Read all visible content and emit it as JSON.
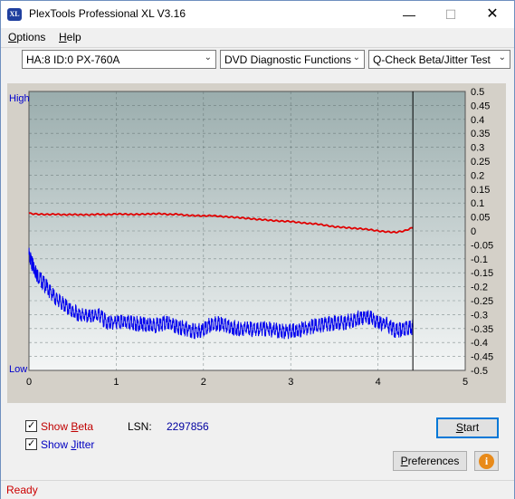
{
  "window": {
    "title": "PlexTools Professional XL V3.16",
    "icon_label": "XL",
    "minimize": "—",
    "maximize": "☐",
    "close": "✕"
  },
  "menu": [
    {
      "label": "Options",
      "mnemonic": "O",
      "rest": "ptions"
    },
    {
      "label": "Help",
      "mnemonic": "H",
      "rest": "elp"
    }
  ],
  "toolbar": {
    "drive": "HA:8 ID:0  PX-760A",
    "function": "DVD Diagnostic Functions",
    "test": "Q-Check Beta/Jitter Test",
    "arrow": "⌄"
  },
  "chart_data": {
    "type": "line",
    "x_ticks": [
      "0",
      "1",
      "2",
      "3",
      "4",
      "5"
    ],
    "xlim": [
      0,
      5
    ],
    "y_left_labels": {
      "top": "High",
      "bottom": "Low"
    },
    "y_right_ticks": [
      "0.5",
      "0.45",
      "0.4",
      "0.35",
      "0.3",
      "0.25",
      "0.2",
      "0.15",
      "0.1",
      "0.05",
      "0",
      "-0.05",
      "-0.1",
      "-0.15",
      "-0.2",
      "-0.25",
      "-0.3",
      "-0.35",
      "-0.4",
      "-0.45",
      "-0.5"
    ],
    "ylim": [
      -0.5,
      0.5
    ],
    "grid": true,
    "end_marker_x": 4.4,
    "series": [
      {
        "color": "#e00000",
        "points": [
          [
            0,
            0.063
          ],
          [
            0.1,
            0.06
          ],
          [
            0.2,
            0.059
          ],
          [
            0.3,
            0.06
          ],
          [
            0.4,
            0.058
          ],
          [
            0.5,
            0.059
          ],
          [
            0.6,
            0.058
          ],
          [
            0.7,
            0.058
          ],
          [
            0.8,
            0.06
          ],
          [
            0.9,
            0.058
          ],
          [
            1.0,
            0.061
          ],
          [
            1.1,
            0.06
          ],
          [
            1.2,
            0.059
          ],
          [
            1.3,
            0.06
          ],
          [
            1.4,
            0.061
          ],
          [
            1.5,
            0.062
          ],
          [
            1.6,
            0.059
          ],
          [
            1.7,
            0.06
          ],
          [
            1.8,
            0.056
          ],
          [
            1.9,
            0.055
          ],
          [
            2.0,
            0.054
          ],
          [
            2.1,
            0.055
          ],
          [
            2.2,
            0.052
          ],
          [
            2.3,
            0.05
          ],
          [
            2.4,
            0.048
          ],
          [
            2.5,
            0.045
          ],
          [
            2.6,
            0.042
          ],
          [
            2.7,
            0.04
          ],
          [
            2.8,
            0.037
          ],
          [
            2.9,
            0.035
          ],
          [
            3.0,
            0.034
          ],
          [
            3.1,
            0.03
          ],
          [
            3.2,
            0.027
          ],
          [
            3.3,
            0.025
          ],
          [
            3.4,
            0.02
          ],
          [
            3.5,
            0.015
          ],
          [
            3.6,
            0.013
          ],
          [
            3.7,
            0.01
          ],
          [
            3.8,
            0.008
          ],
          [
            3.9,
            0.005
          ],
          [
            4.0,
            0.0
          ],
          [
            4.1,
            -0.003
          ],
          [
            4.2,
            -0.005
          ],
          [
            4.3,
            0.0
          ],
          [
            4.4,
            0.012
          ]
        ]
      },
      {
        "color": "#0000ee",
        "points": [
          [
            0,
            -0.085
          ],
          [
            0.05,
            -0.13
          ],
          [
            0.1,
            -0.16
          ],
          [
            0.2,
            -0.2
          ],
          [
            0.3,
            -0.24
          ],
          [
            0.4,
            -0.265
          ],
          [
            0.5,
            -0.29
          ],
          [
            0.6,
            -0.3
          ],
          [
            0.7,
            -0.31
          ],
          [
            0.8,
            -0.3
          ],
          [
            0.9,
            -0.33
          ],
          [
            1.0,
            -0.325
          ],
          [
            1.1,
            -0.33
          ],
          [
            1.2,
            -0.33
          ],
          [
            1.3,
            -0.335
          ],
          [
            1.4,
            -0.34
          ],
          [
            1.5,
            -0.335
          ],
          [
            1.6,
            -0.33
          ],
          [
            1.7,
            -0.345
          ],
          [
            1.8,
            -0.35
          ],
          [
            1.9,
            -0.36
          ],
          [
            2.0,
            -0.355
          ],
          [
            2.1,
            -0.33
          ],
          [
            2.2,
            -0.335
          ],
          [
            2.3,
            -0.345
          ],
          [
            2.4,
            -0.35
          ],
          [
            2.5,
            -0.35
          ],
          [
            2.6,
            -0.355
          ],
          [
            2.7,
            -0.35
          ],
          [
            2.8,
            -0.355
          ],
          [
            2.9,
            -0.36
          ],
          [
            3.0,
            -0.36
          ],
          [
            3.1,
            -0.355
          ],
          [
            3.2,
            -0.345
          ],
          [
            3.3,
            -0.34
          ],
          [
            3.4,
            -0.335
          ],
          [
            3.5,
            -0.33
          ],
          [
            3.6,
            -0.33
          ],
          [
            3.7,
            -0.32
          ],
          [
            3.8,
            -0.31
          ],
          [
            3.9,
            -0.31
          ],
          [
            4.0,
            -0.325
          ],
          [
            4.1,
            -0.335
          ],
          [
            4.2,
            -0.36
          ],
          [
            4.3,
            -0.35
          ],
          [
            4.4,
            -0.345
          ]
        ]
      }
    ]
  },
  "options": {
    "show_beta": {
      "label": "Show Beta",
      "mnemonic": "B",
      "prefix": "Show ",
      "rest": "eta",
      "checked": true,
      "color": "#c00000"
    },
    "show_jitter": {
      "label": "Show Jitter",
      "mnemonic": "J",
      "prefix": "Show ",
      "rest": "itter",
      "checked": true,
      "color": "#0000c0"
    },
    "check_glyph": "✓"
  },
  "lsn": {
    "label": "LSN:",
    "value": "2297856"
  },
  "buttons": {
    "start": "Start",
    "start_mn": "S",
    "start_rest": "tart",
    "preferences": "Preferences",
    "pref_mn": "P",
    "pref_rest": "references",
    "info_glyph": "i"
  },
  "status": {
    "text": "Ready"
  }
}
